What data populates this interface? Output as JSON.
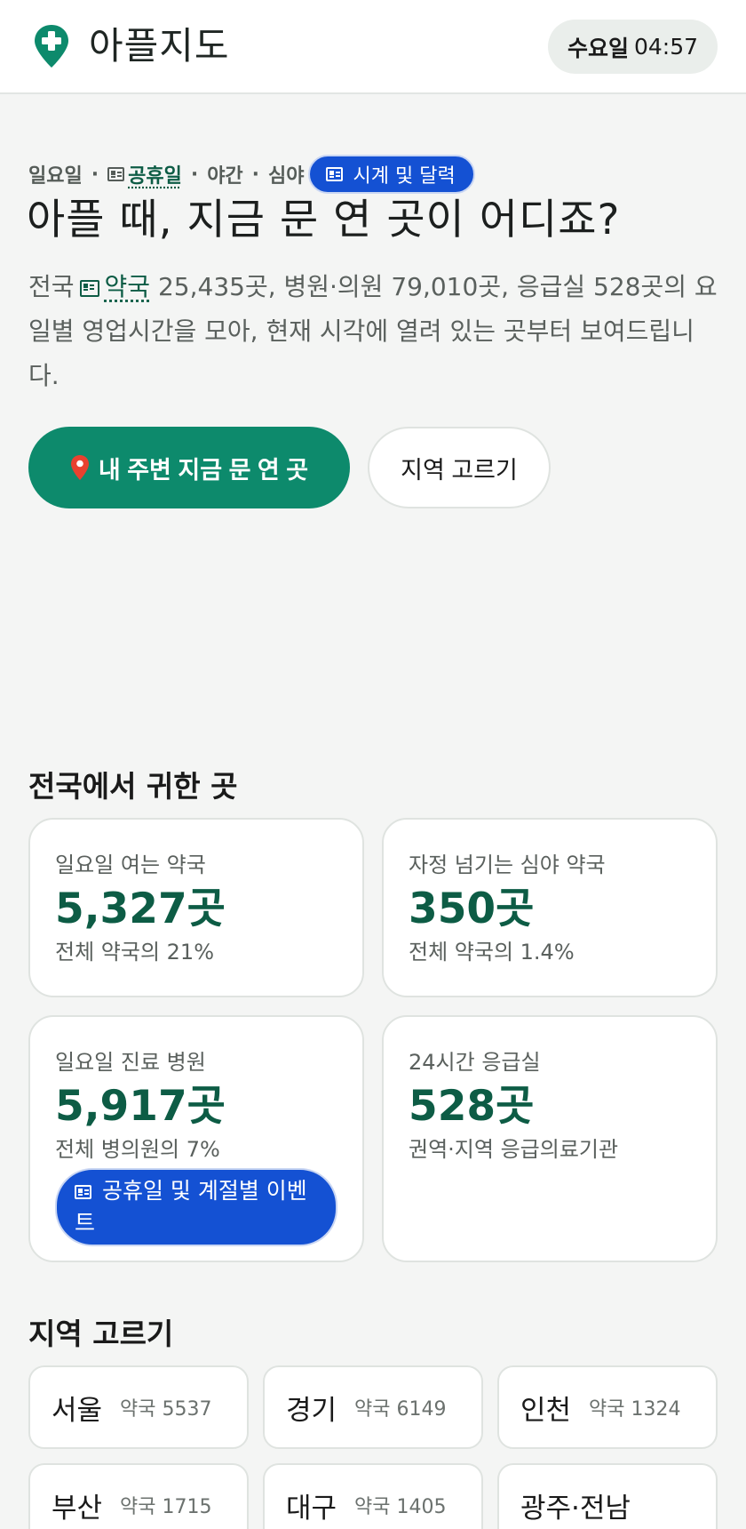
{
  "header": {
    "app_title": "아플지도",
    "clock": {
      "day": "수요일",
      "time": "04:57"
    }
  },
  "hero": {
    "meta": {
      "day": "일요일",
      "holiday": "공휴일",
      "night": "야간",
      "late_night": "심야",
      "chip_label": "시계 및 달력"
    },
    "title": "아플 때, 지금 문 연 곳이 어디죠?",
    "desc": {
      "prefix": "전국",
      "pharmacy_link": "약국",
      "rest": "25,435곳, 병원·의원 79,010곳, 응급실 528곳의 요일별 영업시간을 모아, 현재 시각에 열려 있는 곳부터 보여드립니다."
    },
    "primary_button": "내 주변 지금 문 연 곳",
    "secondary_button": "지역 고르기"
  },
  "rare": {
    "title": "전국에서 귀한 곳",
    "cards": [
      {
        "label": "일요일 여는 약국",
        "value": "5,327곳",
        "note": "전체 약국의 21%"
      },
      {
        "label": "자정 넘기는 심야 약국",
        "value": "350곳",
        "note": "전체 약국의 1.4%"
      },
      {
        "label": "일요일 진료 병원",
        "value": "5,917곳",
        "note": "전체 병의원의 7%",
        "chip": "공휴일 및 계절별 이벤트"
      },
      {
        "label": "24시간 응급실",
        "value": "528곳",
        "note": "권역·지역 응급의료기관"
      }
    ]
  },
  "regions": {
    "title": "지역 고르기",
    "items": [
      {
        "name": "서울",
        "count": "약국 5537"
      },
      {
        "name": "경기",
        "count": "약국 6149"
      },
      {
        "name": "인천",
        "count": "약국 1324"
      },
      {
        "name": "부산",
        "count": "약국 1715"
      },
      {
        "name": "대구",
        "count": "약국 1405"
      },
      {
        "name": "광주·전남",
        "count": ""
      }
    ]
  },
  "colors": {
    "accent": "#0d8a6c",
    "accent_dark": "#0d5c45",
    "chip_blue": "#1451d3"
  },
  "icons": {
    "logo": "medical-pin-icon",
    "primary_button": "map-pin-icon",
    "news": "newspaper-icon"
  }
}
